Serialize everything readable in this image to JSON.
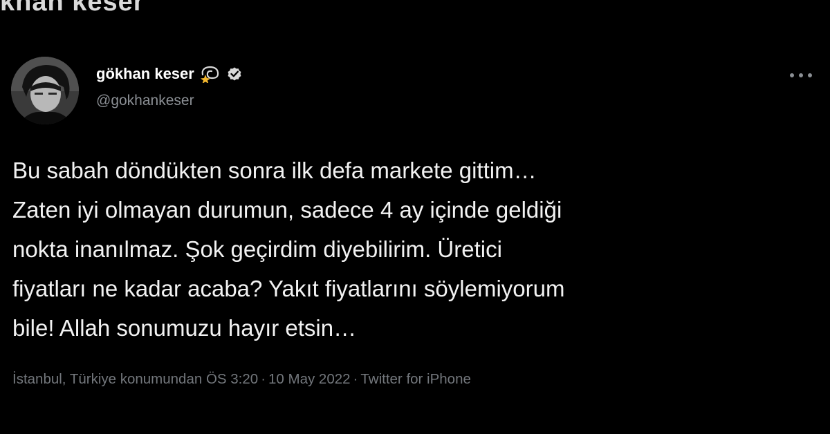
{
  "top_strip": {
    "text": "khan keser"
  },
  "tweet": {
    "author": {
      "display_name": "gökhan keser",
      "handle": "@gokhankeser",
      "name_emoji_icon": "dizzy-star-icon",
      "verified_icon": "verified-badge-icon"
    },
    "text": "Bu sabah döndükten sonra ilk defa markete gittim…\nZaten iyi olmayan durumun, sadece 4 ay içinde geldiği\nnokta inanılmaz. Şok geçirdim diyebilirim. Üretici\nfiyatları ne kadar acaba? Yakıt fiyatlarını söylemiyorum\nbile! Allah sonumuzu hayır etsin…",
    "meta": {
      "location": "İstanbul, Türkiye konumundan",
      "time": "ÖS 3:20",
      "date": "10 May 2022",
      "source": "Twitter for iPhone",
      "separator": "·"
    }
  },
  "colors": {
    "background": "#000000",
    "primary_text": "#f2f2f2",
    "secondary_text": "#8b8f94",
    "meta_text": "#73777c",
    "star_gold": "#f5b82e"
  }
}
